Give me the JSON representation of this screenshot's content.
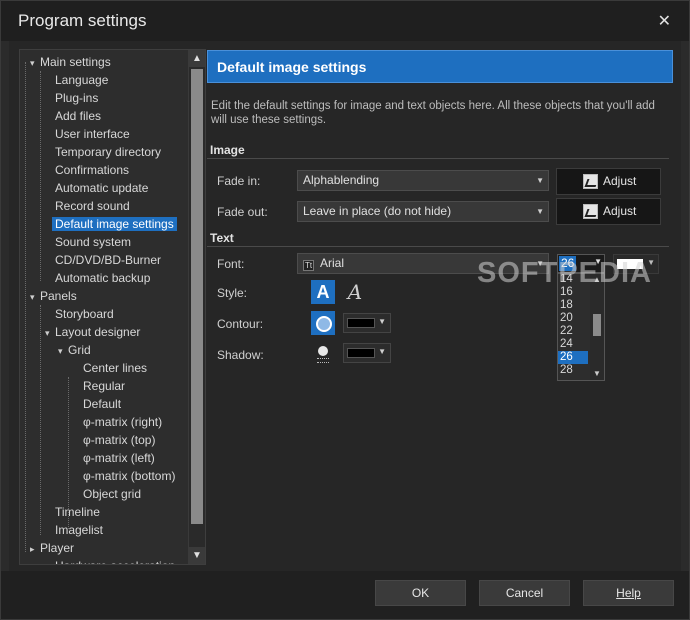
{
  "window": {
    "title": "Program settings",
    "close": "✕"
  },
  "tree": {
    "items": [
      {
        "label": "Main settings",
        "level": 0,
        "expander": "▾"
      },
      {
        "label": "Language",
        "level": 1
      },
      {
        "label": "Plug-ins",
        "level": 1
      },
      {
        "label": "Add files",
        "level": 1
      },
      {
        "label": "User interface",
        "level": 1
      },
      {
        "label": "Temporary directory",
        "level": 1
      },
      {
        "label": "Confirmations",
        "level": 1
      },
      {
        "label": "Automatic update",
        "level": 1
      },
      {
        "label": "Record sound",
        "level": 1
      },
      {
        "label": "Default image settings",
        "level": 1,
        "selected": true
      },
      {
        "label": "Sound system",
        "level": 1
      },
      {
        "label": "CD/DVD/BD-Burner",
        "level": 1
      },
      {
        "label": "Automatic backup",
        "level": 1
      },
      {
        "label": "Panels",
        "level": 0,
        "expander": "▾"
      },
      {
        "label": "Storyboard",
        "level": 1
      },
      {
        "label": "Layout designer",
        "level": 1,
        "expander": "▾"
      },
      {
        "label": "Grid",
        "level": 2,
        "expander": "▾"
      },
      {
        "label": "Center lines",
        "level": 3
      },
      {
        "label": "Regular",
        "level": 3
      },
      {
        "label": "Default",
        "level": 3
      },
      {
        "label": "φ-matrix (right)",
        "level": 3
      },
      {
        "label": "φ-matrix (top)",
        "level": 3
      },
      {
        "label": "φ-matrix (left)",
        "level": 3
      },
      {
        "label": "φ-matrix (bottom)",
        "level": 3
      },
      {
        "label": "Object grid",
        "level": 3
      },
      {
        "label": "Timeline",
        "level": 1
      },
      {
        "label": "Imagelist",
        "level": 1
      },
      {
        "label": "Player",
        "level": 0,
        "expander": "▸"
      },
      {
        "label": "Hardware acceleration",
        "level": 1
      }
    ],
    "scroll_up": "▲",
    "scroll_down": "▼"
  },
  "main": {
    "header": "Default image settings",
    "description": "Edit the default settings for image and text objects here. All these objects that you'll add will use these settings.",
    "image_section": "Image",
    "fade_in_label": "Fade in:",
    "fade_in_value": "Alphablending",
    "fade_out_label": "Fade out:",
    "fade_out_value": "Leave in place (do not hide)",
    "adjust_label": "Adjust",
    "text_section": "Text",
    "font_label": "Font:",
    "font_value": "Arial",
    "font_glyph": "Tt",
    "size_value": "26",
    "size_options": [
      "14",
      "16",
      "18",
      "20",
      "22",
      "24",
      "26",
      "28"
    ],
    "size_selected": "26",
    "style_label": "Style:",
    "style_bold_glyph": "A",
    "style_italic_glyph": "A",
    "contour_label": "Contour:",
    "shadow_label": "Shadow:",
    "combo_arrow": "▼",
    "text_color": "#ffffff",
    "contour_color": "#000000",
    "shadow_color": "#000000"
  },
  "watermark": "SOFTPEDIA",
  "footer": {
    "ok": "OK",
    "cancel": "Cancel",
    "help": "Help"
  },
  "colors": {
    "accent": "#1e6fc0",
    "background": "#262626"
  }
}
